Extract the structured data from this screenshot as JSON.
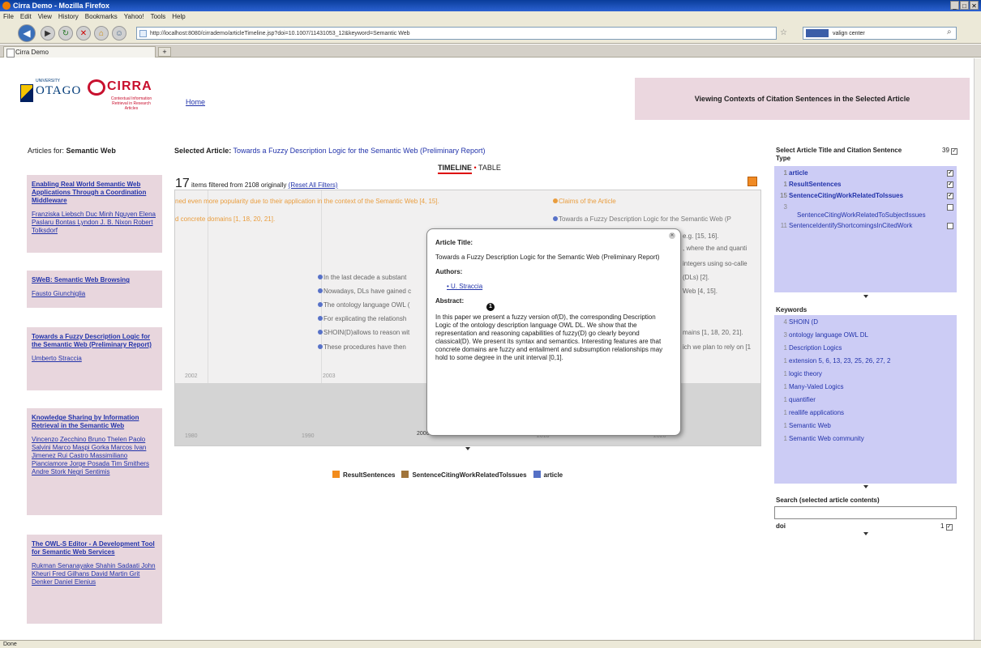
{
  "window": {
    "title": "Cirra Demo - Mozilla Firefox",
    "controls": [
      "_",
      "□",
      "✕"
    ]
  },
  "menu": [
    "File",
    "Edit",
    "View",
    "History",
    "Bookmarks",
    "Yahoo!",
    "Tools",
    "Help"
  ],
  "nav": {
    "url": "http://localhost:8080/cirrademo/articleTimeline.jsp?doi=10.1007/11431053_12&keyword=Semantic Web",
    "search_value": "valign center"
  },
  "tab": {
    "title": "Cirra Demo",
    "new_tab": "+"
  },
  "status": "Done",
  "header": {
    "otago": "OTAGO",
    "otago_top": "UNIVERSITY",
    "cirra": "CIRRA",
    "cirra_sub": "Contextual Information Retrieval in Research Articles",
    "home": "Home",
    "banner": "Viewing Contexts of Citation Sentences in the Selected Article"
  },
  "left": {
    "heading_prefix": "Articles for:",
    "heading_keyword": "Semantic Web",
    "articles": [
      {
        "title": "Enabling Real World Semantic Web Applications Through a Coordination Middleware",
        "authors": "Franziska Liebsch Duc Minh Nguyen Elena Paslaru Bontas Lyndon J. B. Nixon Robert Tolksdorf"
      },
      {
        "title": "SWeB: Semantic Web Browsing",
        "authors": "Fausto Giunchiglia"
      },
      {
        "title": "Towards a Fuzzy Description Logic for the Semantic Web (Preliminary Report)",
        "authors": "Umberto Straccia"
      },
      {
        "title": "Knowledge Sharing by Information Retrieval in the Semantic Web",
        "authors": "Vincenzo Zecchino Bruno Thelen Paolo Salvini Marco Maspi Gorka Marcos Ivan Jimenez Rui Castro Massimiliano Pianciamore Jorge Posada Tim Smithers Andre Stork Negri Sentimis"
      },
      {
        "title": "The OWL-S Editor - A Development Tool for Semantic Web Services",
        "authors": "Rukman Senanayake Shahin Sadaati John Kheuri Fred Gilhans David Martin Grit Denker Daniel Elenius"
      }
    ]
  },
  "center": {
    "selected_label": "Selected Article:",
    "selected_title": "Towards a Fuzzy Description Logic for the Semantic Web (Preliminary Report)",
    "tab_timeline": "TIMELINE",
    "tab_sep": "•",
    "tab_table": "TABLE",
    "count": "17",
    "count_text": "items filtered from 2108 originally",
    "reset": "(Reset All Filters)",
    "events": [
      "ned even more popularity due to their application in the context of the Semantic Web [4, 15].",
      "d concrete domains [1, 18, 20, 21].",
      "Claims of the Article",
      "Towards a Fuzzy Description Logic for the Semantic Web (P",
      "e.g. [15, 16].",
      ", where the and quanti",
      "integers using so-calle",
      "In the last decade a substant",
      "(DLs) [2].",
      "Nowadays, DLs have gained c",
      "Web [4, 15].",
      "The ontology language OWL (",
      "For explicating the relationsh",
      "SHOIN(D)allows to reason wit",
      "mains [1, 18, 20, 21].",
      "These procedures have then",
      "ich we plan to rely on [1"
    ],
    "ticks_top": [
      "2002",
      "2003"
    ],
    "ticks_bottom": [
      "1980",
      "1990",
      "2000",
      "2010",
      "2020"
    ],
    "legend": [
      {
        "label": "ResultSentences",
        "color": "#f28c1d"
      },
      {
        "label": "SentenceCitingWorkRelatedToIssues",
        "color": "#a0743a"
      },
      {
        "label": "article",
        "color": "#5570c6"
      }
    ]
  },
  "popup": {
    "title_label": "Article Title:",
    "title": "Towards a Fuzzy Description Logic for the Semantic Web (Preliminary Report)",
    "authors_label": "Authors:",
    "author": "U. Straccia",
    "marker": "1",
    "abstract_label": "Abstract:",
    "abstract": "In this paper we present a fuzzy version of(D), the corresponding Description Logic of the ontology description language OWL DL. We show that the representation and reasoning capabilities of fuzzy(D) go clearly beyond classical(D). We present its syntax and semantics. Interesting features are that concrete domains are fuzzy and entailment and subsumption relationships may hold to some degree in the unit interval [0,1]."
  },
  "right": {
    "type_heading": "Select Article Title and Citation Sentence Type",
    "type_total": "39",
    "types": [
      {
        "count": "1",
        "label": "article",
        "checked": "✓"
      },
      {
        "count": "1",
        "label": "ResultSentences",
        "checked": "✓"
      },
      {
        "count": "15",
        "label": "SentenceCitingWorkRelatedToIssues",
        "checked": "✓"
      },
      {
        "count": "3",
        "label": "SentenceCitingWorkRelatedToSubjectIssues",
        "checked": ""
      },
      {
        "count": "11",
        "label": "SentenceIdentifyShortcomingsInCitedWork",
        "checked": ""
      }
    ],
    "keywords_heading": "Keywords",
    "keywords": [
      {
        "count": "4",
        "label": "SHOIN (D"
      },
      {
        "count": "3",
        "label": "ontology language OWL DL"
      },
      {
        "count": "1",
        "label": "Description Logics"
      },
      {
        "count": "1",
        "label": "extension 5, 6, 13, 23, 25, 26, 27, 2"
      },
      {
        "count": "1",
        "label": "logic theory"
      },
      {
        "count": "1",
        "label": "Many-Valed Logics"
      },
      {
        "count": "1",
        "label": "quantifier"
      },
      {
        "count": "1",
        "label": "reallife applications"
      },
      {
        "count": "1",
        "label": "Semantic Web"
      },
      {
        "count": "1",
        "label": "Semantic Web community"
      }
    ],
    "search_heading": "Search (selected article contents)",
    "doi_label": "doi",
    "doi_count": "1"
  },
  "colors": {
    "accent_pink": "#e8d6dd",
    "panel_blue": "#ccccf5",
    "link": "#2233aa"
  }
}
